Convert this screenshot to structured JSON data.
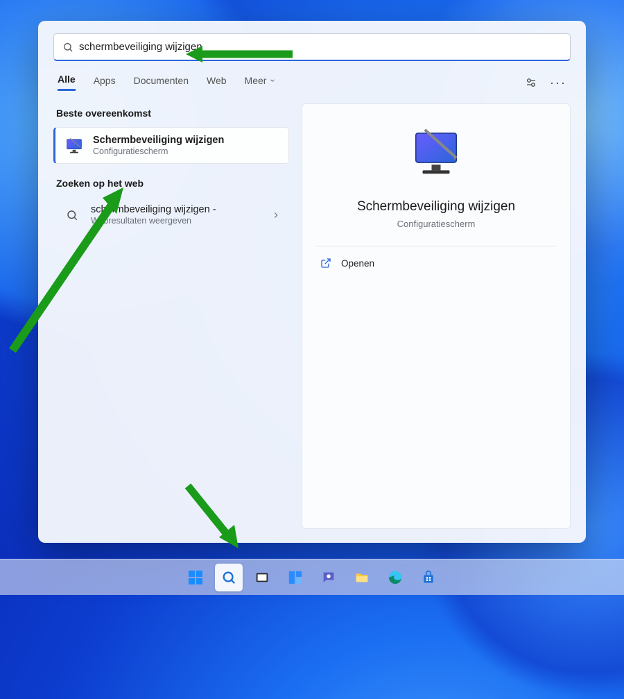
{
  "search": {
    "query": "schermbeveiliging wijzigen",
    "placeholder": ""
  },
  "tabs": {
    "all": "Alle",
    "apps": "Apps",
    "documents": "Documenten",
    "web": "Web",
    "more": "Meer"
  },
  "left": {
    "best_match_label": "Beste overeenkomst",
    "best_result": {
      "title": "Schermbeveiliging wijzigen",
      "subtitle": "Configuratiescherm"
    },
    "web_section_label": "Zoeken op het web",
    "web_result": {
      "title": "schermbeveiliging wijzigen -",
      "subtitle": "Webresultaten weergeven"
    }
  },
  "preview": {
    "title": "Schermbeveiliging wijzigen",
    "subtitle": "Configuratiescherm",
    "open_label": "Openen"
  }
}
